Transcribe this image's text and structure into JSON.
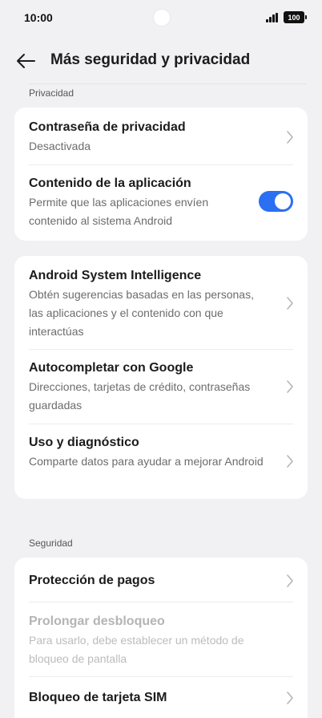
{
  "status_bar": {
    "time": "10:00",
    "battery": "100"
  },
  "header": {
    "title": "Más seguridad y privacidad"
  },
  "sections": {
    "privacy_label": "Privacidad",
    "security_label": "Seguridad"
  },
  "privacy_card": {
    "items": [
      {
        "title": "Contraseña de privacidad",
        "subtitle": "Desactivada"
      },
      {
        "title": "Contenido de la aplicación",
        "subtitle": "Permite que las aplicaciones envíen contenido al sistema Android",
        "toggle_on": true
      }
    ]
  },
  "services_card": {
    "items": [
      {
        "title": "Android System Intelligence",
        "subtitle": "Obtén sugerencias basadas en las personas, las aplicaciones y el contenido con que interactúas"
      },
      {
        "title": "Autocompletar con Google",
        "subtitle": "Direcciones, tarjetas de crédito, contraseñas guardadas"
      },
      {
        "title": "Uso y diagnóstico",
        "subtitle": "Comparte datos para ayudar a mejorar Android"
      }
    ]
  },
  "security_card": {
    "items": [
      {
        "title": "Protección de pagos"
      },
      {
        "title": "Prolongar desbloqueo",
        "subtitle": "Para usarlo, debe establecer un método de bloqueo de pantalla",
        "disabled": true
      },
      {
        "title": "Bloqueo de tarjeta SIM"
      }
    ]
  },
  "colors": {
    "accent": "#2b6ff3",
    "background": "#f1f1f3",
    "card": "#ffffff"
  }
}
